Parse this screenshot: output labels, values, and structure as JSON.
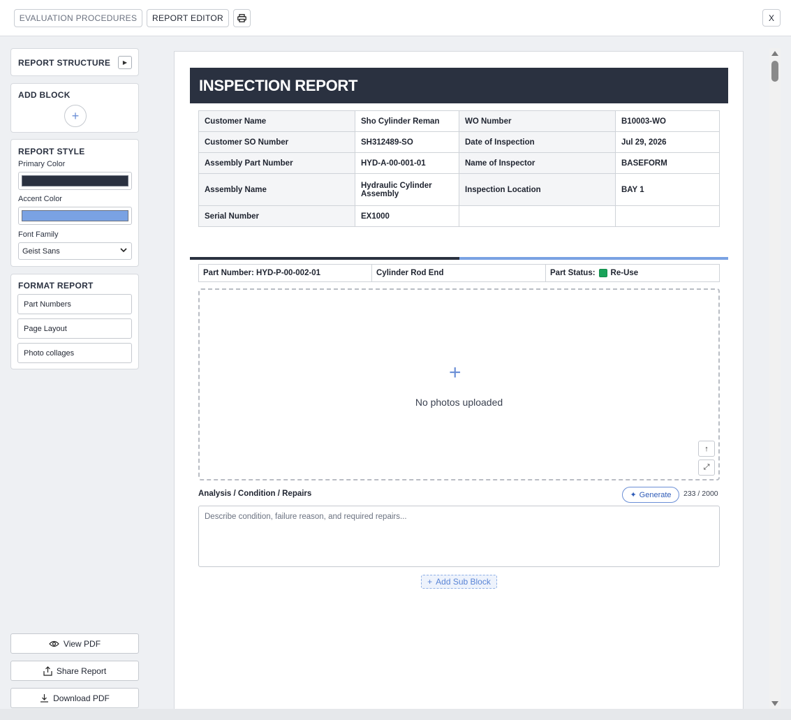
{
  "toolbar": {
    "tab_evaluation": "EVALUATION PROCEDURES",
    "tab_report_editor": "REPORT EDITOR",
    "close_label": "X"
  },
  "sidebar": {
    "report_structure": "REPORT STRUCTURE",
    "add_block": "ADD BLOCK",
    "report_style": "REPORT STYLE",
    "primary_color_label": "Primary Color",
    "primary_color": "#2a3140",
    "accent_color_label": "Accent Color",
    "accent_color": "#7aa2e3",
    "font_family_label": "Font Family",
    "font_family_value": "Geist Sans",
    "format_report": "FORMAT REPORT",
    "format_items": [
      "Part Numbers",
      "Page Layout",
      "Photo collages"
    ],
    "view_pdf": "View PDF",
    "share_report": "Share Report",
    "download_pdf": "Download PDF"
  },
  "report": {
    "title": "INSPECTION REPORT",
    "info_rows": [
      {
        "k1": "Customer Name",
        "v1": "Sho Cylinder Reman",
        "k2": "WO Number",
        "v2": "B10003-WO"
      },
      {
        "k1": "Customer SO Number",
        "v1": "SH312489-SO",
        "k2": "Date of Inspection",
        "v2": "Jul 29, 2026"
      },
      {
        "k1": "Assembly Part Number",
        "v1": "HYD-A-00-001-01",
        "k2": "Name of Inspector",
        "v2": "BASEFORM"
      },
      {
        "k1": "Assembly Name",
        "v1": "Hydraulic Cylinder Assembly",
        "k2": "Inspection Location",
        "v2": "BAY 1"
      },
      {
        "k1": "Serial Number",
        "v1": "EX1000",
        "k2": "",
        "v2": ""
      }
    ],
    "part": {
      "part_number": "Part Number: HYD-P-00-002-01",
      "part_name": "Cylinder Rod End",
      "status_label": "Part Status:",
      "status_value": "Re-Use",
      "status_color": "#1aa35a"
    },
    "photos": {
      "empty_message": "No photos uploaded"
    },
    "analysis": {
      "label": "Analysis / Condition / Repairs",
      "generate_label": "Generate",
      "counter": "233 / 2000",
      "placeholder": "Describe condition, failure reason, and required repairs..."
    },
    "add_sub_block": "Add Sub Block"
  }
}
